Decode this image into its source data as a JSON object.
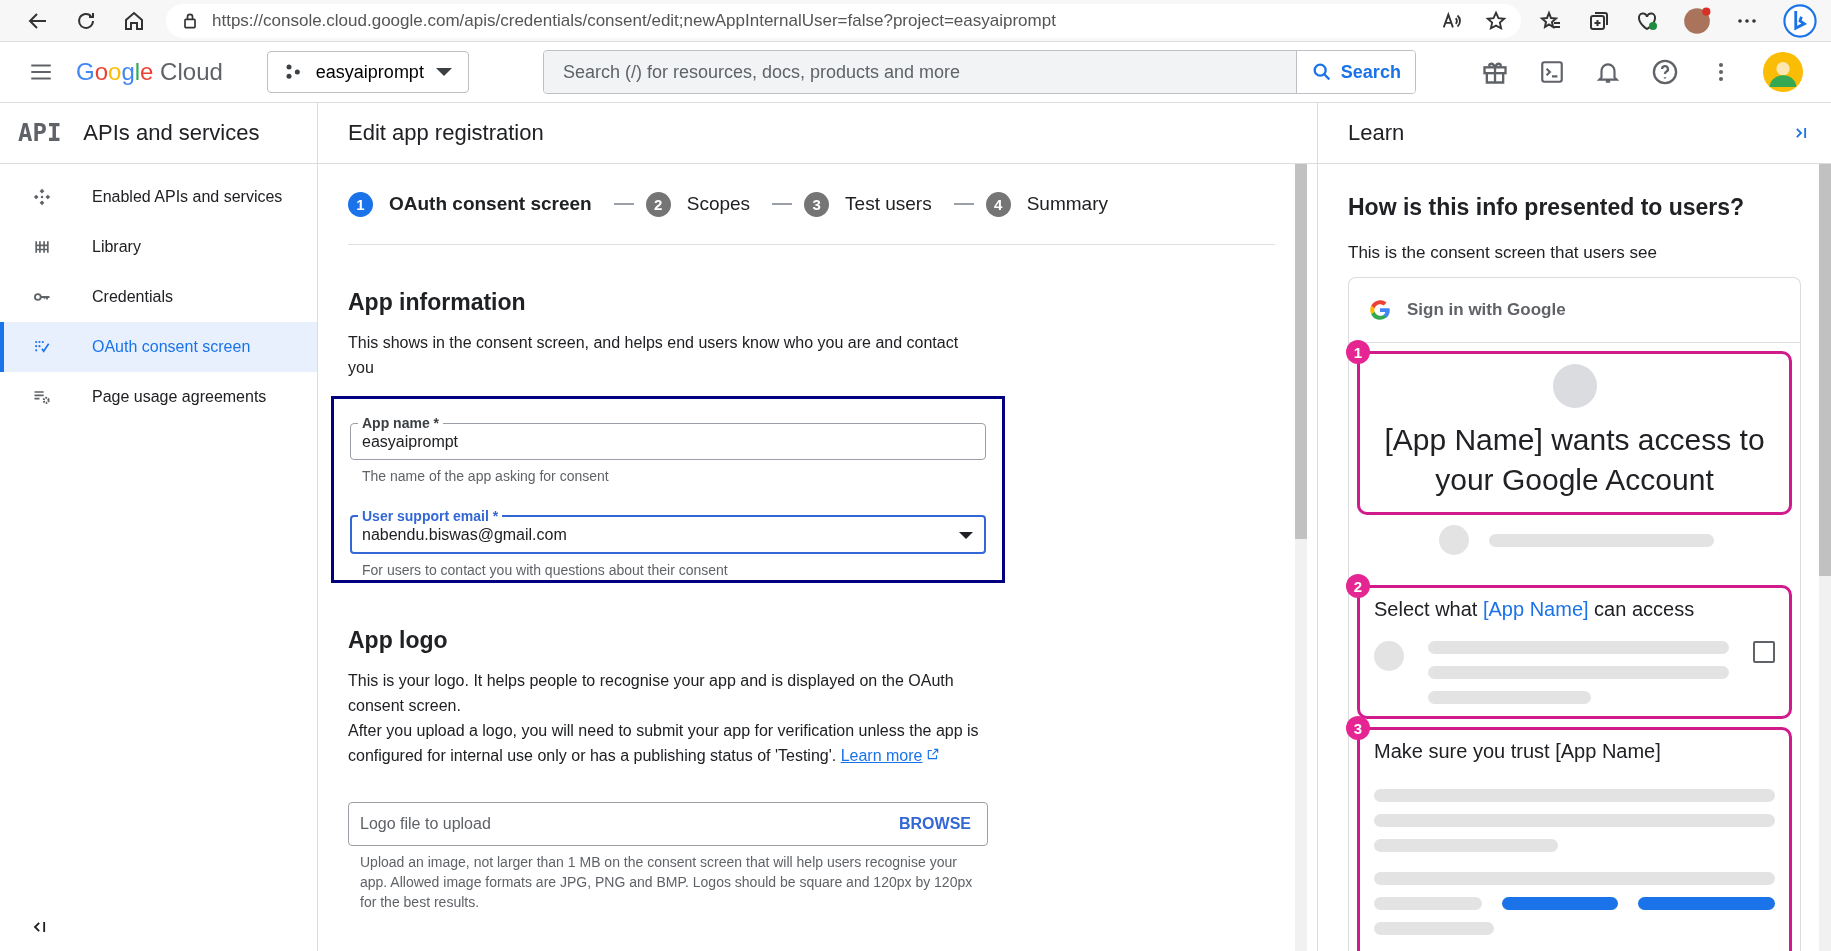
{
  "browser": {
    "url": "https://console.cloud.google.com/apis/credentials/consent/edit;newAppInternalUser=false?project=easyaiprompt"
  },
  "header": {
    "logo": "Google Cloud",
    "project": "easyaiprompt",
    "search_placeholder": "Search (/) for resources, docs, products and more",
    "search_button": "Search"
  },
  "sidebar": {
    "title": "APIs and services",
    "logo": "API",
    "items": [
      {
        "label": "Enabled APIs and services",
        "selected": false
      },
      {
        "label": "Library",
        "selected": false
      },
      {
        "label": "Credentials",
        "selected": false
      },
      {
        "label": "OAuth consent screen",
        "selected": true
      },
      {
        "label": "Page usage agreements",
        "selected": false
      }
    ]
  },
  "main": {
    "title": "Edit app registration",
    "steps": [
      {
        "number": "1",
        "label": "OAuth consent screen",
        "selected": true
      },
      {
        "number": "2",
        "label": "Scopes",
        "selected": false
      },
      {
        "number": "3",
        "label": "Test users",
        "selected": false
      },
      {
        "number": "4",
        "label": "Summary",
        "selected": false
      }
    ],
    "sections": [
      {
        "heading": "App information",
        "highlighted": true,
        "paragraphs": [
          {
            "text": "This shows in the consent screen, and helps end users know who you are and contact you"
          }
        ],
        "fields": [
          {
            "kind": "text",
            "label": "App name *",
            "value": "easyaiprompt",
            "helper": "The name of the app asking for consent",
            "focused": false
          },
          {
            "kind": "select",
            "label": "User support email *",
            "value": "nabendu.biswas@gmail.com",
            "helper": "For users to contact you with questions about their consent",
            "focused": true
          }
        ]
      },
      {
        "heading": "App logo",
        "paragraphs": [
          {
            "text": "This is your logo. It helps people to recognise your app and is displayed on the OAuth consent screen."
          },
          {
            "text": "After you upload a logo, you will need to submit your app for verification unless the app is configured for internal use only or has a publishing status of 'Testing'. ",
            "link": "Learn more"
          }
        ],
        "fields": [
          {
            "kind": "file",
            "placeholder": "Logo file to upload",
            "button": "BROWSE",
            "helper": "Upload an image, not larger than 1 MB on the consent screen that will help users recognise your app. Allowed image formats are JPG, PNG and BMP. Logos should be square and 120px by 120px for the best results.",
            "focused": false
          }
        ]
      }
    ]
  },
  "learn": {
    "title": "Learn",
    "heading": "How is this info presented to users?",
    "subtitle": "This is the consent screen that users see",
    "preview": {
      "sign_in": "Sign in with Google",
      "sections": [
        {
          "number": "1",
          "kind": "headline",
          "title": [
            {
              "text": "[App Name] wants access to your Google Account",
              "accent": false
            }
          ]
        },
        {
          "number": "2",
          "kind": "scopes",
          "title": [
            {
              "text": "Select what ",
              "accent": false
            },
            {
              "text": "[App Name]",
              "accent": true
            },
            {
              "text": " can access",
              "accent": false
            }
          ],
          "checked": false
        },
        {
          "number": "3",
          "kind": "trust",
          "title": [
            {
              "text": "Make sure you trust [App Name]",
              "accent": false
            }
          ]
        }
      ]
    }
  }
}
